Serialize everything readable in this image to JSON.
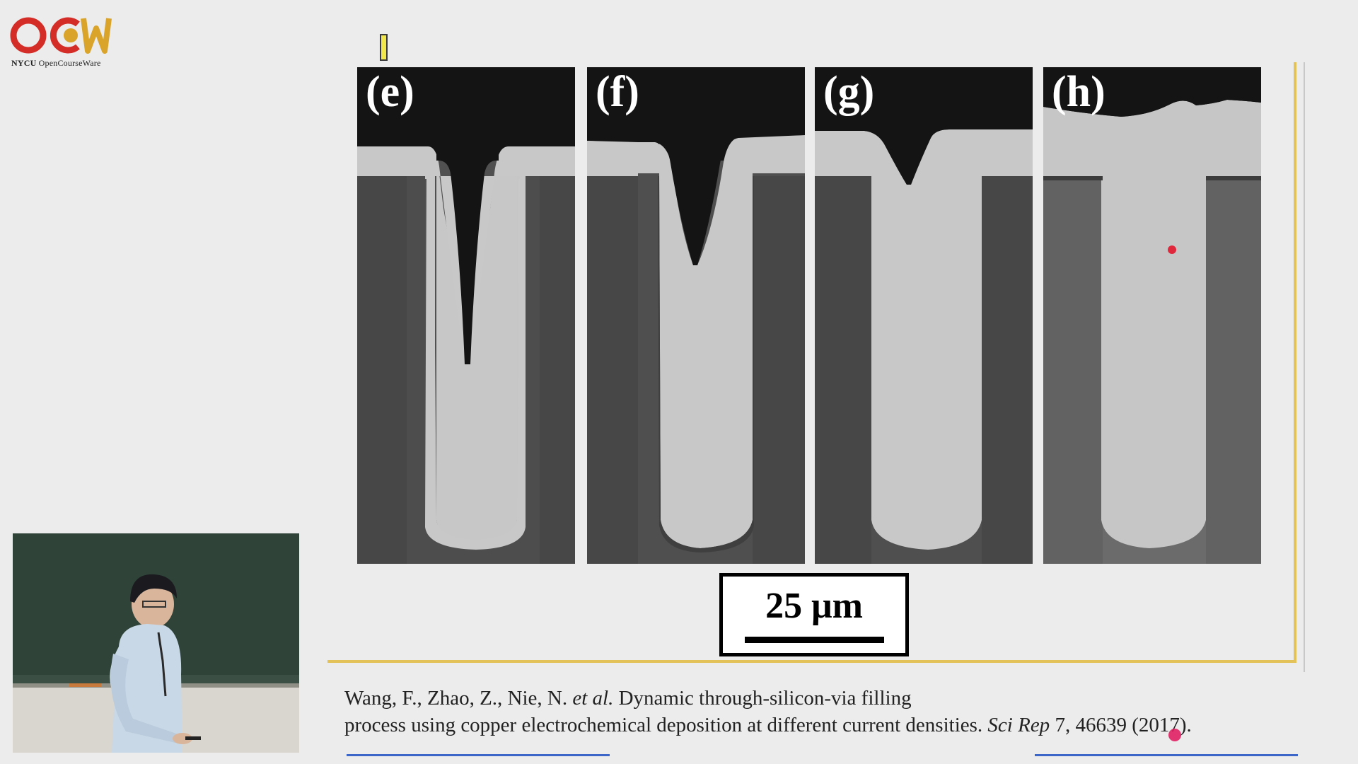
{
  "logo": {
    "name": "NYCU",
    "subtitle": "OpenCourseWare",
    "colors": {
      "red": "#d42c26",
      "gold": "#d9a429"
    }
  },
  "slide": {
    "frame_color": "#e3c25a",
    "panels": [
      {
        "label": "(e)",
        "stage": "partial"
      },
      {
        "label": "(f)",
        "stage": "partial"
      },
      {
        "label": "(g)",
        "stage": "nearly-filled"
      },
      {
        "label": "(h)",
        "stage": "filled"
      }
    ],
    "scale_bar": {
      "text": "25 μm"
    }
  },
  "citation": {
    "authors": "Wang, F., Zhao, Z., Nie, N.",
    "et_al": "et al.",
    "title_part1": "Dynamic through-silicon-via filling",
    "title_part2": "process using copper electrochemical deposition at different current densities.",
    "journal": "Sci Rep",
    "volume_pages": "7, 46639 (2017).",
    "link_color": "#3d66c9"
  },
  "video": {
    "subject": "lecturer at chalkboard"
  }
}
